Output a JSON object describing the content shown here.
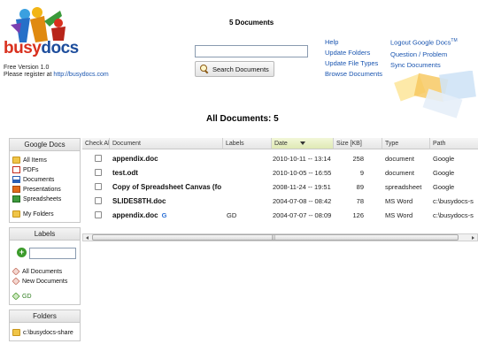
{
  "app": {
    "logo_word_busy": "busy",
    "logo_word_docs": "docs",
    "version": "Free Version 1.0",
    "register_prefix": "Please register at ",
    "register_link": "http://busydocs.com"
  },
  "header": {
    "doc_count": "5 Documents",
    "search_placeholder": "",
    "search_button": "Search Documents",
    "links_col1": [
      "Help",
      "Update Folders",
      "Update File Types",
      "Browse Documents"
    ],
    "links_col2_logout": "Logout Google Docs",
    "links_col2_logout_sup": "TM",
    "links_col2": [
      "Question / Problem",
      "Sync Documents"
    ]
  },
  "main": {
    "title": "All Documents: 5"
  },
  "sidebar": {
    "google_docs": {
      "title": "Google Docs",
      "items": [
        {
          "label": "All Items",
          "icon": "folder-icon"
        },
        {
          "label": "PDFs",
          "icon": "pdf-icon"
        },
        {
          "label": "Documents",
          "icon": "document-icon"
        },
        {
          "label": "Presentations",
          "icon": "presentation-icon"
        },
        {
          "label": "Spreadsheets",
          "icon": "spreadsheet-icon"
        },
        {
          "label": "My Folders",
          "icon": "folder-icon"
        }
      ]
    },
    "labels": {
      "title": "Labels",
      "add_symbol": "+",
      "items": [
        {
          "label": "All Documents",
          "icon": "tag-icon"
        },
        {
          "label": "New Documents",
          "icon": "tag-icon"
        },
        {
          "label": "GD",
          "icon": "green-tag-icon"
        }
      ]
    },
    "folders": {
      "title": "Folders",
      "items": [
        {
          "label": "c:\\busydocs-share",
          "icon": "folder-icon"
        }
      ]
    }
  },
  "table": {
    "columns": [
      "Check All",
      "Document",
      "Labels",
      "Date",
      "Size [KB]",
      "Type",
      "Path"
    ],
    "sorted_column": "Date",
    "rows": [
      {
        "document": "appendix.doc",
        "label": "",
        "date": "2010-10-11 -- 13:14",
        "size": "258",
        "type": "document",
        "path": "Google",
        "google_icon": ""
      },
      {
        "document": "test.odt",
        "label": "",
        "date": "2010-10-05 -- 16:55",
        "size": "9",
        "type": "document",
        "path": "Google",
        "google_icon": ""
      },
      {
        "document": "Copy of Spreadsheet Canvas (fo",
        "label": "",
        "date": "2008-11-24 -- 19:51",
        "size": "89",
        "type": "spreadsheet",
        "path": "Google",
        "google_icon": ""
      },
      {
        "document": "SLIDES8TH.doc",
        "label": "",
        "date": "2004-07-08 -- 08:42",
        "size": "78",
        "type": "MS Word",
        "path": "c:\\busydocs-s",
        "google_icon": ""
      },
      {
        "document": "appendix.doc",
        "label": "GD",
        "date": "2004-07-07 -- 08:09",
        "size": "126",
        "type": "MS Word",
        "path": "c:\\busydocs-s",
        "google_icon": "G"
      }
    ],
    "scroll_grip": "|||"
  },
  "colors": {
    "link": "#1a55b0",
    "logo_red": "#d9301e",
    "logo_blue": "#1d4d9c",
    "sorted_header": "#dfe9b4"
  }
}
